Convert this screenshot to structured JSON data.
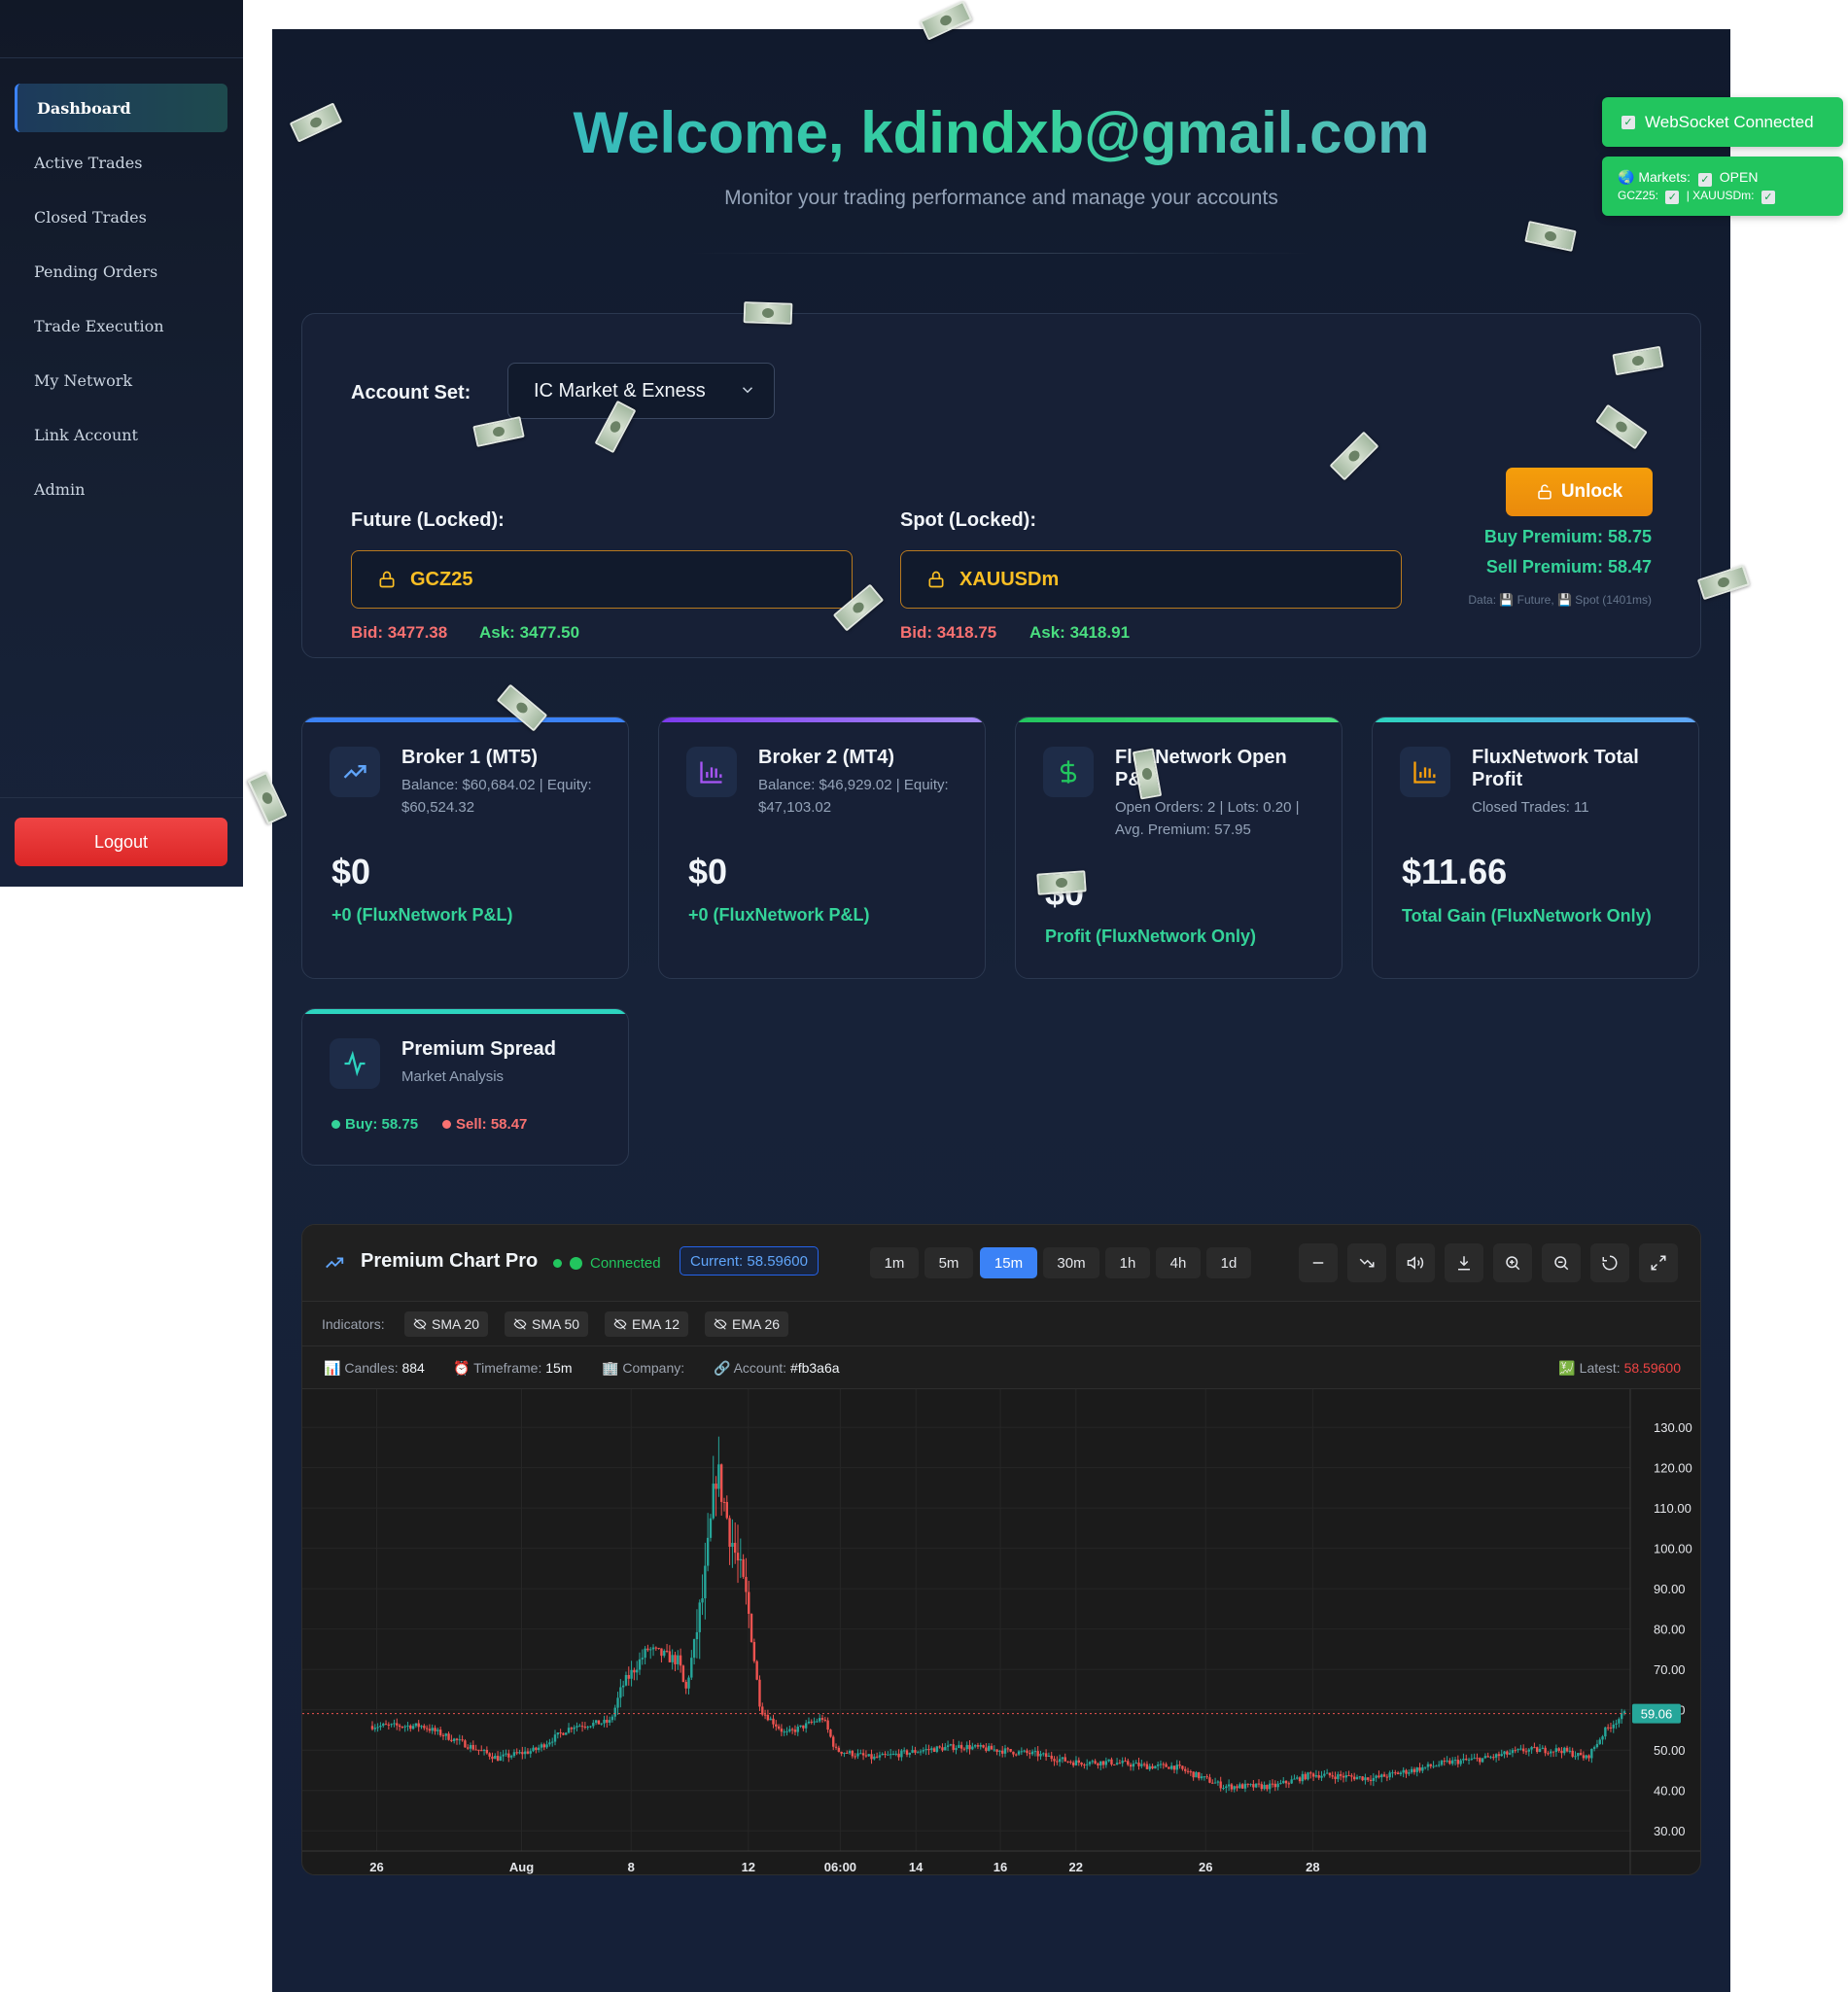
{
  "sidebar": {
    "items": [
      {
        "label": "Dashboard",
        "active": true
      },
      {
        "label": "Active Trades"
      },
      {
        "label": "Closed Trades"
      },
      {
        "label": "Pending Orders"
      },
      {
        "label": "Trade Execution"
      },
      {
        "label": "My Network"
      },
      {
        "label": "Link Account"
      },
      {
        "label": "Admin"
      }
    ],
    "logout_label": "Logout"
  },
  "header": {
    "welcome": "Welcome, kdindxb@gmail.com",
    "subtitle": "Monitor your trading performance and manage your accounts"
  },
  "account": {
    "label": "Account Set:",
    "selected": "IC Market & Exness",
    "future_label": "Future (Locked):",
    "future_symbol": "GCZ25",
    "future_bid": "Bid: 3477.38",
    "future_ask": "Ask: 3477.50",
    "spot_label": "Spot (Locked):",
    "spot_symbol": "XAUUSDm",
    "spot_bid": "Bid: 3418.75",
    "spot_ask": "Ask: 3418.91",
    "unlock_label": "Unlock",
    "buy_premium": "Buy Premium: 58.75",
    "sell_premium": "Sell Premium: 58.47",
    "data_info": "Data: 💾 Future, 💾 Spot (1401ms)"
  },
  "cards": [
    {
      "title": "Broker 1 (MT5)",
      "desc": "Balance: $60,684.02 | Equity: $60,524.32",
      "value": "$0",
      "note": "+0 (FluxNetwork P&L)",
      "icon": "trending-up-icon",
      "accent": "#3b82f6"
    },
    {
      "title": "Broker 2 (MT4)",
      "desc": "Balance: $46,929.02 | Equity: $47,103.02",
      "value": "$0",
      "note": "+0 (FluxNetwork P&L)",
      "icon": "bar-chart-icon",
      "accent": "#8b5cf6"
    },
    {
      "title": "FluxNetwork Open P&L",
      "desc": "Open Orders: 2 | Lots: 0.20 | Avg. Premium: 57.95",
      "value": "$0",
      "note": "Profit (FluxNetwork Only)",
      "icon": "dollar-icon",
      "accent": "#22c55e"
    },
    {
      "title": "FluxNetwork Total Profit",
      "desc": "Closed Trades: 11",
      "value": "$11.66",
      "note": "Total Gain (FluxNetwork Only)",
      "icon": "bar-chart-icon",
      "accent": "#2dd4bf"
    },
    {
      "title": "Premium Spread",
      "desc": "Market Analysis",
      "buy": "Buy: 58.75",
      "sell": "Sell: 58.47",
      "icon": "activity-icon",
      "accent": "#2dd4bf"
    }
  ],
  "chart_panel": {
    "title": "Premium Chart Pro",
    "status": "Connected",
    "current": "Current: 58.59600",
    "timeframes": [
      "1m",
      "5m",
      "15m",
      "30m",
      "1h",
      "4h",
      "1d"
    ],
    "selected_timeframe": "15m",
    "tools": [
      "minus-icon",
      "trend-down-icon",
      "volume-icon",
      "download-icon",
      "zoom-in-icon",
      "zoom-out-icon",
      "reset-icon",
      "expand-icon"
    ],
    "indicators_label": "Indicators:",
    "indicators": [
      "SMA 20",
      "SMA 50",
      "EMA 12",
      "EMA 26"
    ],
    "info": {
      "candles_label": "Candles:",
      "candles": "884",
      "timeframe_label": "Timeframe:",
      "timeframe": "15m",
      "company_label": "Company:",
      "account_label": "Account:",
      "account": "#fb3a6a",
      "latest_label": "Latest:",
      "latest": "58.59600"
    }
  },
  "chart_data": {
    "type": "candlestick",
    "title": "Premium Chart Pro",
    "ylim": [
      25,
      137
    ],
    "y_ticks": [
      "130.00",
      "120.00",
      "110.00",
      "100.00",
      "90.00",
      "80.00",
      "70.00",
      "60.00",
      "50.00",
      "40.00",
      "30.00"
    ],
    "x_ticks": [
      "26",
      "Aug",
      "8",
      "12",
      "06:00",
      "14",
      "16",
      "22",
      "26",
      "28"
    ],
    "last_price_label": "59.06",
    "last_price": 59.06,
    "price_path": [
      [
        0,
        56
      ],
      [
        0.04,
        56
      ],
      [
        0.07,
        52
      ],
      [
        0.1,
        48
      ],
      [
        0.13,
        50
      ],
      [
        0.16,
        56
      ],
      [
        0.19,
        57
      ],
      [
        0.2,
        66
      ],
      [
        0.22,
        75
      ],
      [
        0.245,
        72
      ],
      [
        0.25,
        64
      ],
      [
        0.265,
        90
      ],
      [
        0.275,
        120
      ],
      [
        0.285,
        105
      ],
      [
        0.295,
        92
      ],
      [
        0.3,
        85
      ],
      [
        0.31,
        60
      ],
      [
        0.33,
        54
      ],
      [
        0.36,
        58
      ],
      [
        0.37,
        50
      ],
      [
        0.4,
        48
      ],
      [
        0.44,
        50
      ],
      [
        0.47,
        51
      ],
      [
        0.5,
        50
      ],
      [
        0.53,
        49
      ],
      [
        0.56,
        47
      ],
      [
        0.59,
        47
      ],
      [
        0.62,
        46
      ],
      [
        0.64,
        46
      ],
      [
        0.68,
        41
      ],
      [
        0.72,
        41
      ],
      [
        0.75,
        44
      ],
      [
        0.8,
        43
      ],
      [
        0.83,
        45
      ],
      [
        0.86,
        47
      ],
      [
        0.89,
        48
      ],
      [
        0.92,
        50
      ],
      [
        0.95,
        50
      ],
      [
        0.97,
        48
      ],
      [
        0.985,
        55
      ],
      [
        1.0,
        59
      ]
    ],
    "grid": true
  },
  "toasts": {
    "ws": "WebSocket Connected",
    "markets_label": "Markets:",
    "markets_status": "OPEN",
    "symbols_line_a": "GCZ25:",
    "symbols_line_b": "| XAUUSDm:"
  }
}
